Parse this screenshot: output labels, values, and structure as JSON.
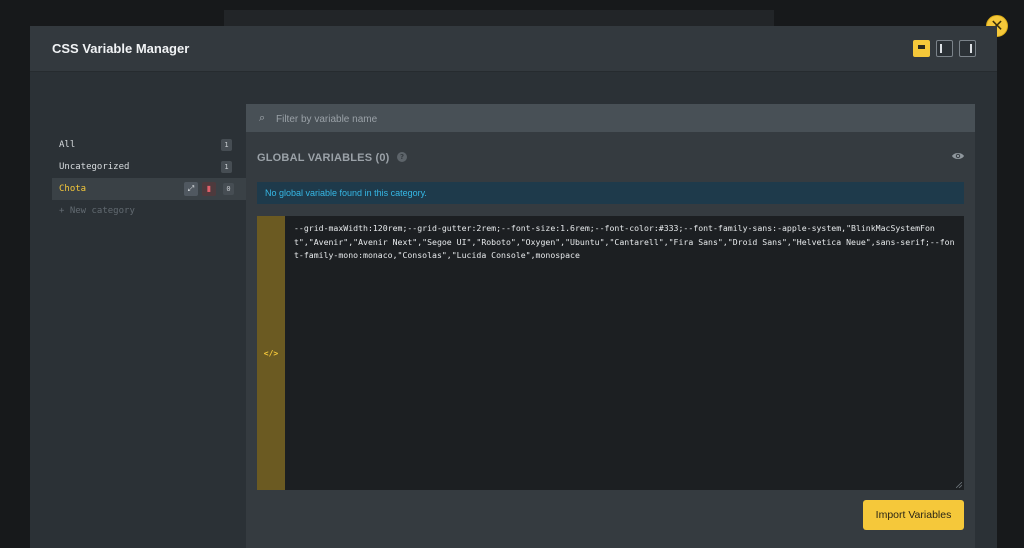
{
  "modal": {
    "title": "CSS Variable Manager",
    "close_icon": "close-icon"
  },
  "layout_buttons": [
    {
      "name": "layout-full-icon",
      "active": true
    },
    {
      "name": "layout-left-panel-icon",
      "active": false
    },
    {
      "name": "layout-right-panel-icon",
      "active": false
    }
  ],
  "sidebar": {
    "items": [
      {
        "label": "All",
        "count": "1",
        "active": false
      },
      {
        "label": "Uncategorized",
        "count": "1",
        "active": false
      },
      {
        "label": "Chota",
        "count": "0",
        "active": true,
        "actions": [
          "expand-icon",
          "trash-icon"
        ]
      }
    ],
    "new_category": "+ New category"
  },
  "main": {
    "filter_placeholder": "Filter by variable name",
    "filter_icon": "search-icon",
    "section_title": "GLOBAL VARIABLES (0)",
    "help_icon": "?",
    "eye_icon": "eye-icon",
    "info_message": "No global variable found in this category.",
    "code_icon": "</>",
    "editor_value": "--grid-maxWidth:120rem;--grid-gutter:2rem;--font-size:1.6rem;--font-color:#333;--font-family-sans:-apple-system,\"BlinkMacSystemFont\",\"Avenir\",\"Avenir Next\",\"Segoe UI\",\"Roboto\",\"Oxygen\",\"Ubuntu\",\"Cantarell\",\"Fira Sans\",\"Droid Sans\",\"Helvetica Neue\",sans-serif;--font-family-mono:monaco,\"Consolas\",\"Lucida Console\",monospace",
    "import_button": "Import Variables"
  },
  "colors": {
    "accent": "#f5c83a",
    "modal_bg": "#2b3136",
    "panel_bg": "#353b40",
    "info_text": "#36b8e6"
  }
}
